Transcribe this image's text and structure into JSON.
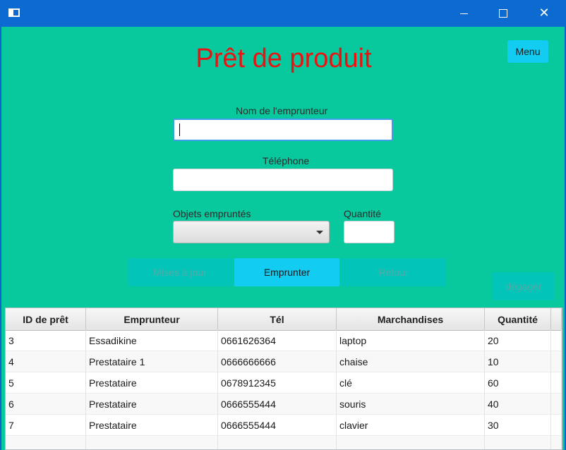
{
  "window": {
    "icon": "app-window-icon",
    "minimize": "minimize-icon",
    "maximize": "maximize-icon",
    "close": "close-icon"
  },
  "page": {
    "title": "Prêt de produit",
    "menu_label": "Menu"
  },
  "form": {
    "borrower_label": "Nom de l'emprunteur",
    "borrower_value": "",
    "phone_label": "Téléphone",
    "phone_value": "",
    "objects_label": "Objets empruntés",
    "objects_selected": "",
    "quantity_label": "Quantité",
    "quantity_value": ""
  },
  "actions": {
    "update_label": "Mises à jour",
    "borrow_label": "Emprunter",
    "return_label": "Retour",
    "clear_label": "dégager"
  },
  "table": {
    "columns": [
      "ID de prêt",
      "Emprunteur",
      "Tél",
      "Marchandises",
      "Quantité"
    ],
    "rows": [
      [
        "3",
        "Essadikine",
        "0661626364",
        "laptop",
        "20"
      ],
      [
        "4",
        "Prestataire 1",
        "0666666666",
        "chaise",
        "10"
      ],
      [
        "5",
        "Prestataire",
        "0678912345",
        "clé",
        "60"
      ],
      [
        "6",
        "Prestataire",
        "0666555444",
        "souris",
        "40"
      ],
      [
        "7",
        "Prestataire",
        "0666555444",
        "clavier",
        "30"
      ]
    ]
  },
  "colors": {
    "background": "#08c99e",
    "title": "#ee1111",
    "accent": "#12ccf1",
    "titlebar": "#0c6ad0"
  }
}
